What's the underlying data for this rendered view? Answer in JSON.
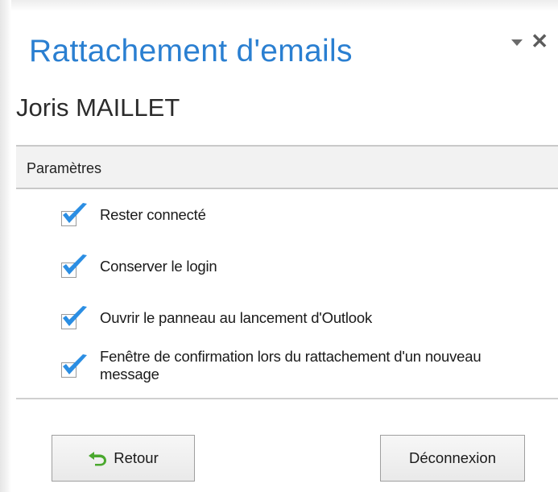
{
  "pane": {
    "title": "Rattachement d'emails"
  },
  "user": {
    "name": "Joris MAILLET"
  },
  "section": {
    "title": "Paramètres"
  },
  "options": [
    {
      "label": "Rester connecté",
      "checked": true
    },
    {
      "label": "Conserver le login",
      "checked": true
    },
    {
      "label": "Ouvrir le panneau au lancement d'Outlook",
      "checked": true
    },
    {
      "label": "Fenêtre de confirmation lors du rattachement d'un nouveau message",
      "checked": true
    }
  ],
  "buttons": {
    "back_label": "Retour",
    "logout_label": "Déconnexion"
  },
  "colors": {
    "title_blue": "#2a7fd1",
    "check_blue": "#2b8ee3",
    "back_icon_green": "#4aa82e"
  },
  "icons": {
    "pane_menu": "dropdown-arrow-icon",
    "pane_close": "close-icon",
    "back": "back-arrow-icon",
    "check": "checkmark-icon"
  }
}
